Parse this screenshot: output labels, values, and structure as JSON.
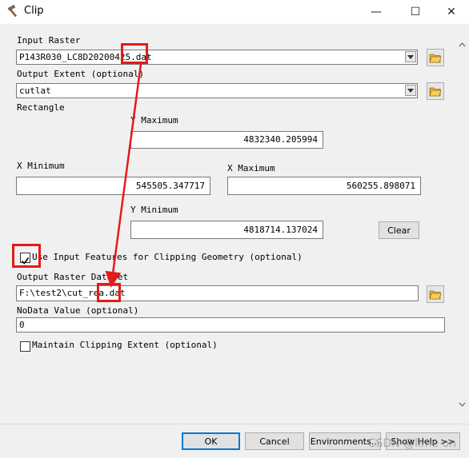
{
  "window": {
    "title": "Clip",
    "minimize": "—",
    "maximize": "☐",
    "close": "✕"
  },
  "form": {
    "input_raster_label": "Input Raster",
    "input_raster_value": "P143R030_LC8D20200425.dat",
    "output_extent_label": "Output Extent (optional)",
    "output_extent_value": "cutlat",
    "rectangle_label": "Rectangle",
    "y_max_label": "Y Maximum",
    "y_max_value": "4832340.205994",
    "x_min_label": "X Minimum",
    "x_min_value": "545505.347717",
    "x_max_label": "X Maximum",
    "x_max_value": "560255.898071",
    "y_min_label": "Y Minimum",
    "y_min_value": "4818714.137024",
    "clear_label": "Clear",
    "use_input_features_label": "Use Input Features for Clipping Geometry (optional)",
    "use_input_features_checked": true,
    "output_dataset_label": "Output Raster Dataset",
    "output_dataset_value": "F:\\test2\\cut_rea.dat",
    "nodata_label": "NoData Value (optional)",
    "nodata_value": "0",
    "maintain_extent_label": "Maintain Clipping Extent (optional)",
    "maintain_extent_checked": false
  },
  "buttons": {
    "ok": "OK",
    "cancel": "Cancel",
    "environments": "Environments...",
    "show_help": "Show Help >>"
  },
  "watermark": "CSDN @lime on",
  "colors": {
    "annotation": "#e31b1b",
    "default_button_border": "#0078d7"
  }
}
